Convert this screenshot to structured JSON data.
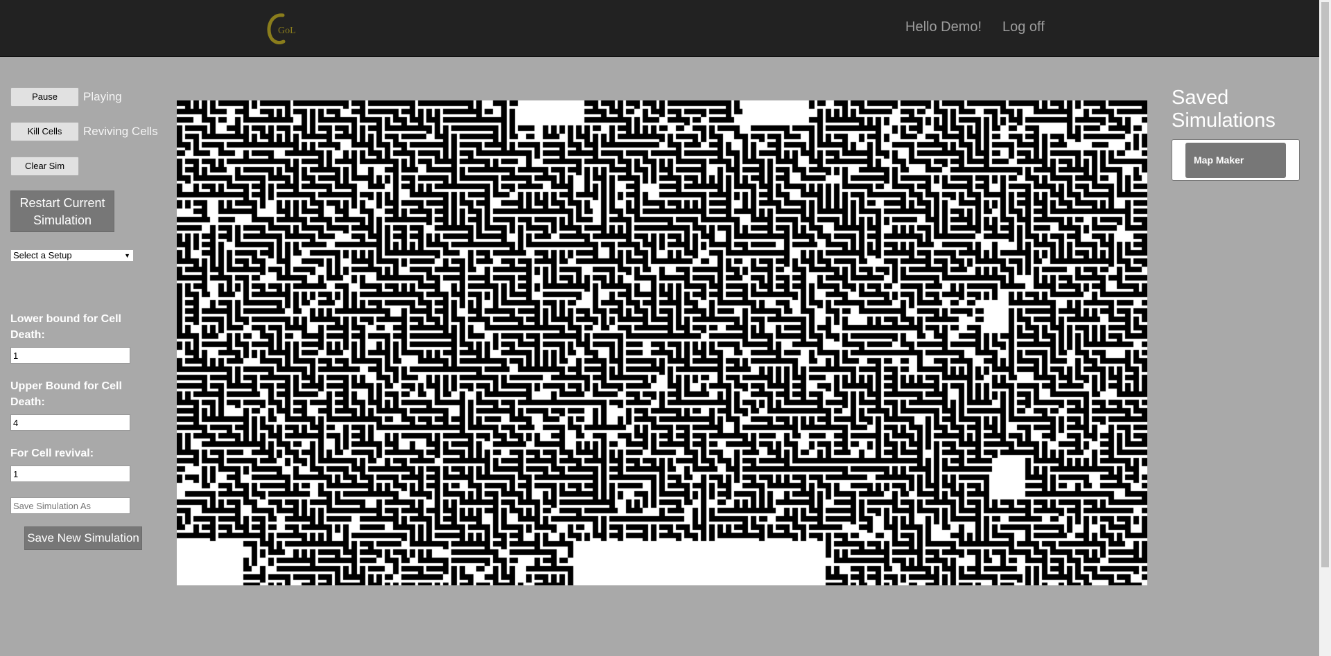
{
  "header": {
    "logo_text": "GoL",
    "greeting": "Hello Demo!",
    "logoff": "Log off"
  },
  "controls": {
    "pause_label": "Pause",
    "play_status": "Playing",
    "kill_label": "Kill Cells",
    "revive_status": "Reviving Cells",
    "clear_label": "Clear Sim",
    "restart_label": "Restart Current Simulation",
    "setup_select": "Select a Setup"
  },
  "rules": {
    "lower_label": "Lower bound for Cell Death:",
    "lower_value": "1",
    "upper_label": "Upper Bound for Cell Death:",
    "upper_value": "4",
    "revival_label": "For Cell revival:",
    "revival_value": "1"
  },
  "save": {
    "placeholder": "Save Simulation As",
    "button_label": "Save New Simulation"
  },
  "saved": {
    "title": "Saved Simulations",
    "items": [
      {
        "label": "Map Maker"
      }
    ]
  },
  "colors": {
    "topbar": "#222222",
    "background": "#a9a9a9",
    "cell_alive": "#000000",
    "cell_dead": "#ffffff",
    "logo": "#8a7d1c"
  },
  "icons": {
    "logo": "cgol-logo-icon",
    "select_arrow": "chevron-down-icon"
  }
}
